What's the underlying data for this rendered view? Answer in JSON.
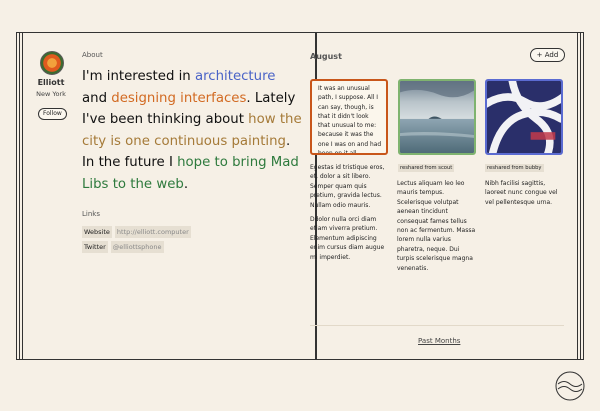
{
  "profile": {
    "name": "Elliott",
    "location": "New York",
    "follow_label": "Follow"
  },
  "about": {
    "label": "About",
    "segments": [
      {
        "text": "I'm interested in ",
        "style": "plain"
      },
      {
        "text": "architecture",
        "style": "blue"
      },
      {
        "text": " and ",
        "style": "plain"
      },
      {
        "text": "designing interfaces",
        "style": "orange"
      },
      {
        "text": ". Lately I've been thinking about ",
        "style": "plain"
      },
      {
        "text": "how the city is one continuous painting",
        "style": "brown"
      },
      {
        "text": ". In the future I ",
        "style": "plain"
      },
      {
        "text": "hope to bring Mad Libs to the web",
        "style": "green"
      },
      {
        "text": ".",
        "style": "plain"
      }
    ]
  },
  "links": {
    "label": "Links",
    "items": [
      {
        "label": "Website",
        "value": "http://elliott.computer"
      },
      {
        "label": "Twitter",
        "value": "@elliottsphone"
      }
    ]
  },
  "feed": {
    "month": "August",
    "add_label": "+ Add",
    "text_card": "It was an unusual path, I suppose. All I can say, though, is that it didn't look that unusual to me: because it was the one I was on and had been on it all",
    "cards": [
      {
        "reshare": "",
        "paragraphs": [
          "Egestas id tristique eros, et, dolor a sit libero. Semper quam quis pretium, gravida lectus. Nullam odio mauris.",
          "Ddolor nulla orci diam etiam viverra pretium. Elementum adipiscing enim cursus diam augue mi imperdiet."
        ]
      },
      {
        "reshare": "reshared from scout",
        "paragraphs": [
          "Lectus aliquam leo leo mauris tempus. Scelerisque volutpat aenean tincidunt consequat fames tellus non ac fermentum. Massa lorem nulla varius pharetra, neque. Dui turpis scelerisque magna venenatis."
        ]
      },
      {
        "reshare": "reshared from bubby",
        "paragraphs": [
          "Nibh facilisi sagittis, laoreet nunc congue vel vel pellentesque urna."
        ]
      }
    ],
    "past_label": "Past Months"
  },
  "colors": {
    "accent_blue": "#4a63c7",
    "accent_orange": "#d26a22",
    "accent_brown": "#a57a38",
    "accent_green": "#2e7a3d",
    "background": "#f6f0e6"
  },
  "icons": {
    "logo": "wave-circle-logo-icon"
  }
}
